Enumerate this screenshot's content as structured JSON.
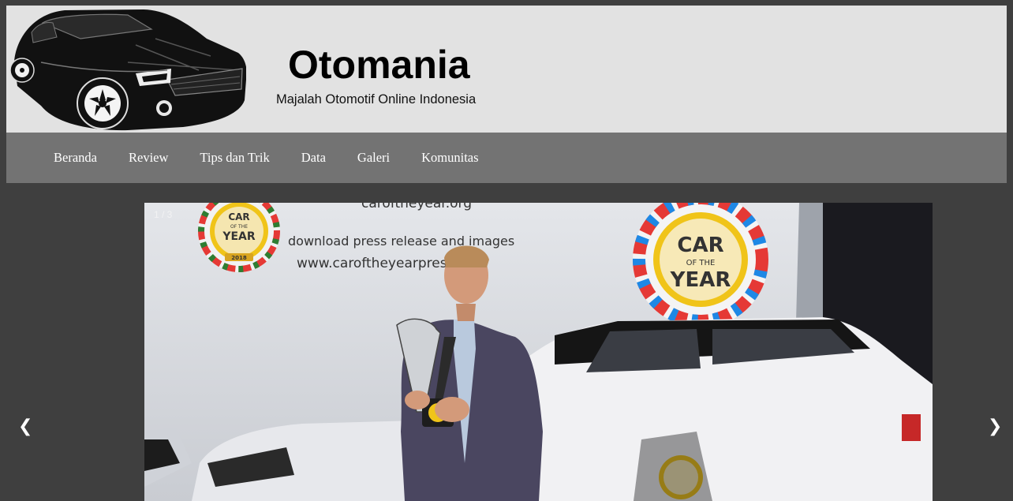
{
  "site": {
    "title": "Otomania",
    "tagline": "Majalah Otomotif Online Indonesia",
    "logo_icon": "sports-car-silhouette-icon"
  },
  "nav": {
    "items": [
      {
        "label": "Beranda"
      },
      {
        "label": "Review"
      },
      {
        "label": "Tips dan Trik"
      },
      {
        "label": "Data"
      },
      {
        "label": "Galeri"
      },
      {
        "label": "Komunitas"
      }
    ]
  },
  "slideshow": {
    "counter": "1 / 3",
    "prev_label": "❮",
    "next_label": "❯",
    "image": {
      "banner_line1": "download press release and images",
      "banner_line2": "www.caroftheyearpress.org",
      "banner_top": "caroftheyear.org",
      "badge_line1": "CAR",
      "badge_line2": "OF THE",
      "badge_line3": "YEAR",
      "badge_year": "2018"
    }
  },
  "colors": {
    "page_bg": "#3f3f3f",
    "header_bg": "#e2e2e2",
    "nav_bg": "#737373",
    "nav_text": "#ffffff"
  }
}
